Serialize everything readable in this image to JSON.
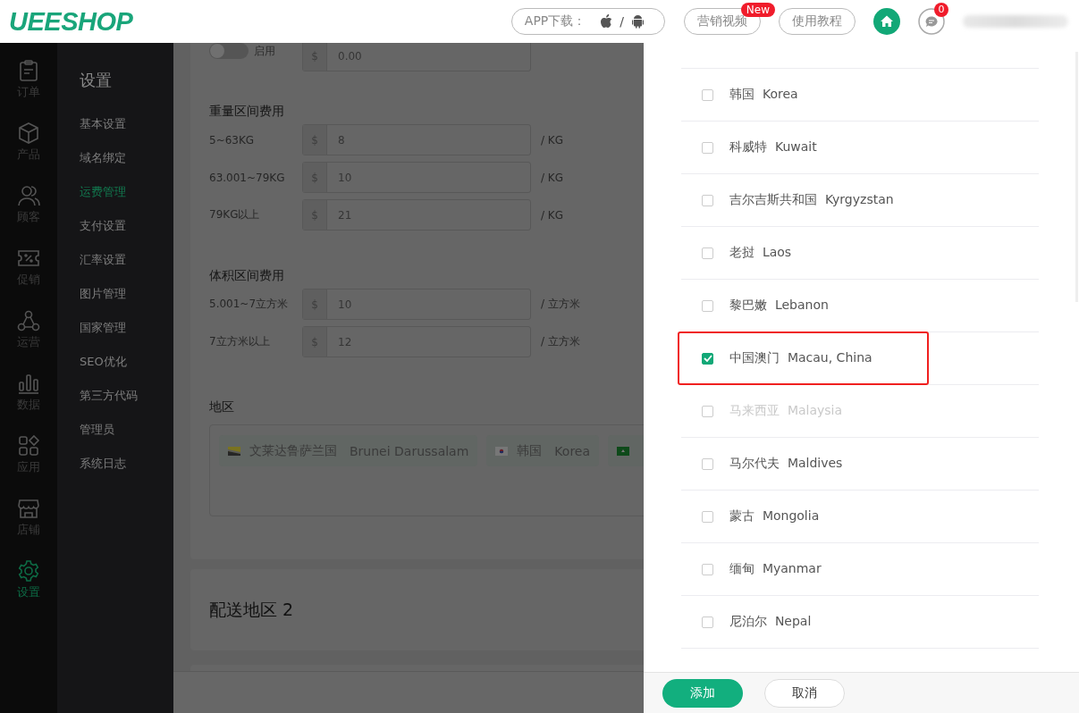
{
  "header": {
    "logo": "UEESHOP",
    "app_download": {
      "label": "APP下载：",
      "separator": "/"
    },
    "buttons": [
      {
        "label": "营销视频",
        "badge": "New"
      },
      {
        "label": "使用教程"
      }
    ],
    "messages": {
      "badge": "0"
    }
  },
  "nav_rail": [
    {
      "label": "订单",
      "selected": false
    },
    {
      "label": "产品",
      "selected": false
    },
    {
      "label": "顾客",
      "selected": false
    },
    {
      "label": "促销",
      "selected": false
    },
    {
      "label": "运营",
      "selected": false
    },
    {
      "label": "数据",
      "selected": false
    },
    {
      "label": "应用",
      "selected": false
    },
    {
      "label": "店铺",
      "selected": false
    },
    {
      "label": "设置",
      "selected": true
    }
  ],
  "submenu": {
    "title": "设置",
    "items": [
      {
        "label": "基本设置",
        "selected": false
      },
      {
        "label": "域名绑定",
        "selected": false
      },
      {
        "label": "运费管理",
        "selected": true
      },
      {
        "label": "支付设置",
        "selected": false
      },
      {
        "label": "汇率设置",
        "selected": false
      },
      {
        "label": "图片管理",
        "selected": false
      },
      {
        "label": "国家管理",
        "selected": false
      },
      {
        "label": "SEO优化",
        "selected": false
      },
      {
        "label": "第三方代码",
        "selected": false
      },
      {
        "label": "管理员",
        "selected": false
      },
      {
        "label": "系统日志",
        "selected": false
      }
    ]
  },
  "form": {
    "toggle": {
      "label": "启用",
      "on": false
    },
    "base_fee": {
      "prefix": "$",
      "value": "0.00"
    },
    "weight_section": {
      "title": "重量区间费用",
      "rows": [
        {
          "label": "5~63KG",
          "prefix": "$",
          "value": "8",
          "unit": "/ KG"
        },
        {
          "label": "63.001~79KG",
          "prefix": "$",
          "value": "10",
          "unit": "/ KG"
        },
        {
          "label": "79KG以上",
          "prefix": "$",
          "value": "21",
          "unit": "/ KG"
        }
      ]
    },
    "volume_section": {
      "title": "体积区间费用",
      "rows": [
        {
          "label": "5.001~7立方米",
          "prefix": "$",
          "value": "10",
          "unit": "/ 立方米"
        },
        {
          "label": "7立方米以上",
          "prefix": "$",
          "value": "12",
          "unit": "/ 立方米"
        }
      ]
    },
    "region": {
      "title": "地区",
      "tags": [
        {
          "kind": "full",
          "name_zh": "文莱达鲁萨兰国",
          "name_en": "Brunei Darussalam"
        },
        {
          "kind": "full",
          "name_zh": "韩国",
          "name_en": "Korea"
        },
        {
          "kind": "cut"
        }
      ]
    }
  },
  "zone_2": {
    "title": "配送地区 2"
  },
  "drawer": {
    "countries": [
      {
        "name_zh": "韩国",
        "name_en": "Korea",
        "checked": false,
        "disabled": false,
        "highlighted": false
      },
      {
        "name_zh": "科威特",
        "name_en": "Kuwait",
        "checked": false,
        "disabled": false,
        "highlighted": false
      },
      {
        "name_zh": "吉尔吉斯共和国",
        "name_en": "Kyrgyzstan",
        "checked": false,
        "disabled": false,
        "highlighted": false
      },
      {
        "name_zh": "老挝",
        "name_en": "Laos",
        "checked": false,
        "disabled": false,
        "highlighted": false
      },
      {
        "name_zh": "黎巴嫩",
        "name_en": "Lebanon",
        "checked": false,
        "disabled": false,
        "highlighted": false
      },
      {
        "name_zh": "中国澳门",
        "name_en": "Macau, China",
        "checked": true,
        "disabled": false,
        "highlighted": true
      },
      {
        "name_zh": "马来西亚",
        "name_en": "Malaysia",
        "checked": false,
        "disabled": true,
        "highlighted": false
      },
      {
        "name_zh": "马尔代夫",
        "name_en": "Maldives",
        "checked": false,
        "disabled": false,
        "highlighted": false
      },
      {
        "name_zh": "蒙古",
        "name_en": "Mongolia",
        "checked": false,
        "disabled": false,
        "highlighted": false
      },
      {
        "name_zh": "缅甸",
        "name_en": "Myanmar",
        "checked": false,
        "disabled": false,
        "highlighted": false
      },
      {
        "name_zh": "尼泊尔",
        "name_en": "Nepal",
        "checked": false,
        "disabled": false,
        "highlighted": false
      }
    ],
    "buttons": [
      {
        "label": "添加",
        "kind": "primary"
      },
      {
        "label": "取消",
        "kind": "secondary"
      }
    ]
  }
}
